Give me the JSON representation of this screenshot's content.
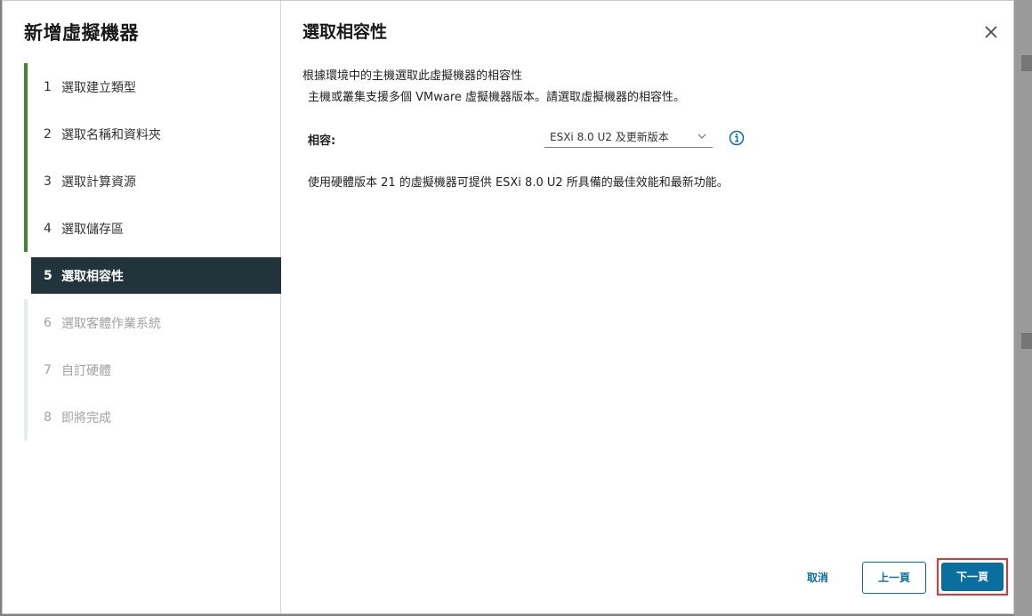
{
  "sidebar": {
    "title": "新增虛擬機器",
    "steps": [
      {
        "num": "1",
        "label": "選取建立類型",
        "state": "done"
      },
      {
        "num": "2",
        "label": "選取名稱和資料夾",
        "state": "done"
      },
      {
        "num": "3",
        "label": "選取計算資源",
        "state": "done"
      },
      {
        "num": "4",
        "label": "選取儲存區",
        "state": "done"
      },
      {
        "num": "5",
        "label": "選取相容性",
        "state": "active"
      },
      {
        "num": "6",
        "label": "選取客體作業系統",
        "state": "future"
      },
      {
        "num": "7",
        "label": "自訂硬體",
        "state": "future"
      },
      {
        "num": "8",
        "label": "即將完成",
        "state": "future"
      }
    ]
  },
  "main": {
    "title": "選取相容性",
    "subtitle": "根據環境中的主機選取此虛擬機器的相容性",
    "description": "主機或叢集支援多個 VMware 虛擬機器版本。請選取虛擬機器的相容性。",
    "compat_label": "相容:",
    "compat_value": "ESXi 8.0 U2 及更新版本",
    "note": "使用硬體版本 21 的虛擬機器可提供 ESXi 8.0 U2 所具備的最佳效能和最新功能。"
  },
  "footer": {
    "cancel": "取消",
    "back": "上一頁",
    "next": "下一頁"
  },
  "colors": {
    "accent": "#0a6e9f",
    "done_bar": "#3f8a2e",
    "active_step_bg": "#21333b",
    "highlight_border": "#e4323f"
  }
}
